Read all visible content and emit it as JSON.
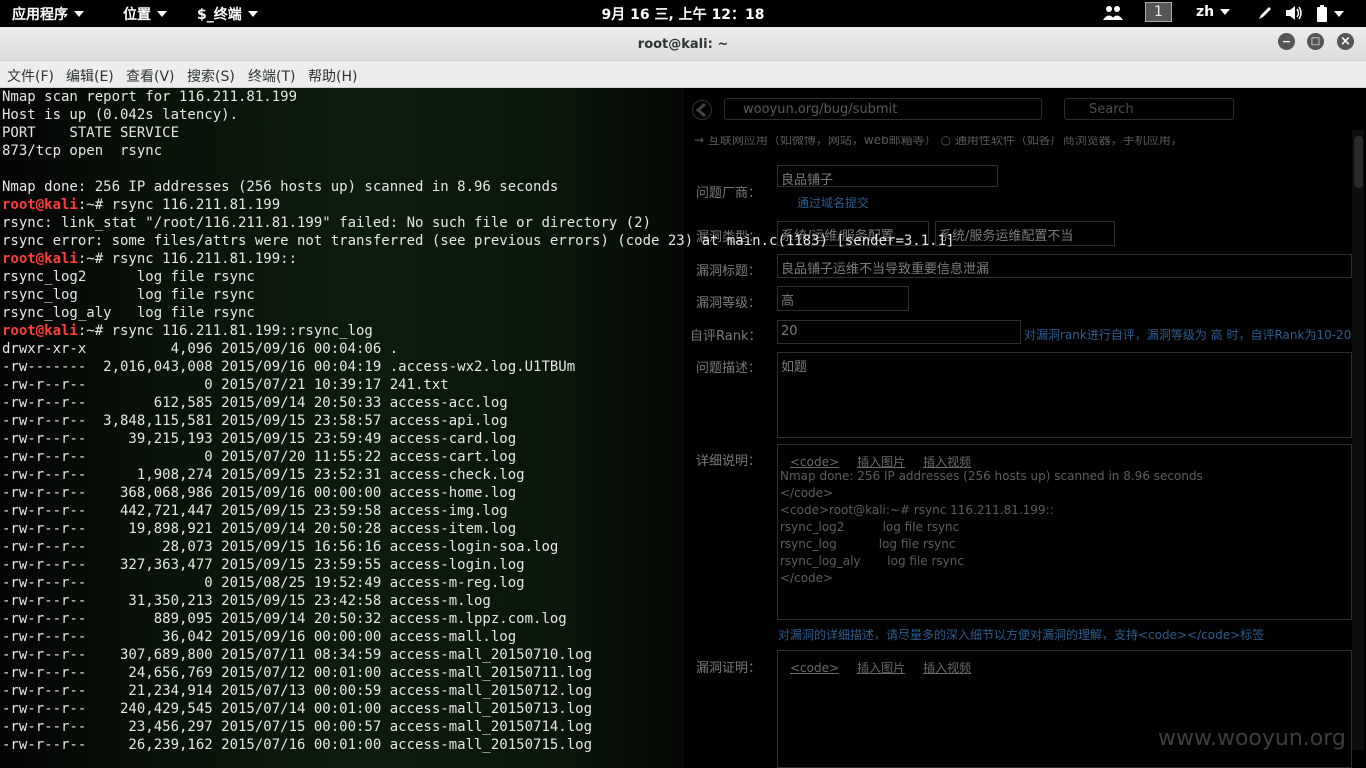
{
  "topbar": {
    "apps_label": "应用程序",
    "places_label": "位置",
    "terminal_label": "$_终端",
    "clock": "9月 16 三, 上午 12：18",
    "workspace": "1",
    "language": "zh"
  },
  "window": {
    "title": "root@kali: ~",
    "minimize": "−",
    "maximize": "□",
    "close": "×"
  },
  "menubar": {
    "file": "文件(F)",
    "edit": "编辑(E)",
    "view": "查看(V)",
    "search": "搜索(S)",
    "terminal": "终端(T)",
    "help": "帮助(H)"
  },
  "terminal": {
    "lines": [
      {
        "t": "Nmap scan report for 116.211.81.199"
      },
      {
        "t": "Host is up (0.042s latency)."
      },
      {
        "t": "PORT    STATE SERVICE"
      },
      {
        "t": "873/tcp open  rsync"
      },
      {
        "t": ""
      },
      {
        "t": "Nmap done: 256 IP addresses (256 hosts up) scanned in 8.96 seconds"
      },
      {
        "p": "root@kali",
        "t": ":~# rsync 116.211.81.199"
      },
      {
        "t": "rsync: link_stat \"/root/116.211.81.199\" failed: No such file or directory (2)"
      },
      {
        "t": "rsync error: some files/attrs were not transferred (see previous errors) (code 23) at main.c(1183) [sender=3.1.1]"
      },
      {
        "p": "root@kali",
        "t": ":~# rsync 116.211.81.199::"
      },
      {
        "t": "rsync_log2      log file rsync"
      },
      {
        "t": "rsync_log       log file rsync"
      },
      {
        "t": "rsync_log_aly   log file rsync"
      },
      {
        "p": "root@kali",
        "t": ":~# rsync 116.211.81.199::rsync_log"
      },
      {
        "t": "drwxr-xr-x          4,096 2015/09/16 00:04:06 ."
      },
      {
        "t": "-rw-------  2,016,043,008 2015/09/16 00:04:19 .access-wx2.log.U1TBUm"
      },
      {
        "t": "-rw-r--r--              0 2015/07/21 10:39:17 241.txt"
      },
      {
        "t": "-rw-r--r--        612,585 2015/09/14 20:50:33 access-acc.log"
      },
      {
        "t": "-rw-r--r--  3,848,115,581 2015/09/15 23:58:57 access-api.log"
      },
      {
        "t": "-rw-r--r--     39,215,193 2015/09/15 23:59:49 access-card.log"
      },
      {
        "t": "-rw-r--r--              0 2015/07/20 11:55:22 access-cart.log"
      },
      {
        "t": "-rw-r--r--      1,908,274 2015/09/15 23:52:31 access-check.log"
      },
      {
        "t": "-rw-r--r--    368,068,986 2015/09/16 00:00:00 access-home.log"
      },
      {
        "t": "-rw-r--r--    442,721,447 2015/09/15 23:59:58 access-img.log"
      },
      {
        "t": "-rw-r--r--     19,898,921 2015/09/14 20:50:28 access-item.log"
      },
      {
        "t": "-rw-r--r--         28,073 2015/09/15 16:56:16 access-login-soa.log"
      },
      {
        "t": "-rw-r--r--    327,363,477 2015/09/15 23:59:55 access-login.log"
      },
      {
        "t": "-rw-r--r--              0 2015/08/25 19:52:49 access-m-reg.log"
      },
      {
        "t": "-rw-r--r--     31,350,213 2015/09/15 23:42:58 access-m.log"
      },
      {
        "t": "-rw-r--r--        889,095 2015/09/14 20:50:32 access-m.lppz.com.log"
      },
      {
        "t": "-rw-r--r--         36,042 2015/09/16 00:00:00 access-mall.log"
      },
      {
        "t": "-rw-r--r--    307,689,800 2015/07/11 08:34:59 access-mall_20150710.log"
      },
      {
        "t": "-rw-r--r--     24,656,769 2015/07/12 00:01:00 access-mall_20150711.log"
      },
      {
        "t": "-rw-r--r--     21,234,914 2015/07/13 00:00:59 access-mall_20150712.log"
      },
      {
        "t": "-rw-r--r--    240,429,545 2015/07/14 00:01:00 access-mall_20150713.log"
      },
      {
        "t": "-rw-r--r--     23,456,297 2015/07/15 00:00:57 access-mall_20150714.log"
      },
      {
        "t": "-rw-r--r--     26,239,162 2015/07/16 00:01:00 access-mall_20150715.log"
      }
    ]
  },
  "browser": {
    "url": "wooyun.org/bug/submit",
    "search_placeholder": "Search",
    "top_cut": "→ 互联网应用（如微博，网站，web邮箱等） ○ 通用性软件（如各厂商浏览器，手机应用，",
    "vendor_label": "问题厂商：",
    "vendor_value": "良品铺子",
    "vendor_link": "通过域名提交",
    "type_label": "漏洞类型：",
    "type_value1": "系统/运维/服务配置",
    "type_value2": "系统/服务运维配置不当",
    "title_label": "漏洞标题：",
    "title_value": "良品铺子运维不当导致重要信息泄漏",
    "level_label": "漏洞等级：",
    "level_value": "高",
    "rank_label": "自评Rank：",
    "rank_value": "20",
    "rank_note": "对漏洞rank进行自评，漏洞等级为 高 时，自评Rank为10-20",
    "desc_label": "问题描述：",
    "desc_value": "如题",
    "detail_label": "详细说明：",
    "toolbar_code": "<code>",
    "toolbar_img": "插入图片",
    "toolbar_video": "插入视频",
    "detail_text": "Nmap done: 256 IP addresses (256 hosts up) scanned in 8.96 seconds\n</code>\n<code>root@kali:~# rsync 116.211.81.199::\nrsync_log2          log file rsync\nrsync_log           log file rsync\nrsync_log_aly       log file rsync\n</code>",
    "detail_note": "对漏洞的详细描述，请尽量多的深入细节以方便对漏洞的理解，支持<code></code>标签",
    "proof_label": "漏洞证明：",
    "watermark": "www.wooyun.org"
  }
}
